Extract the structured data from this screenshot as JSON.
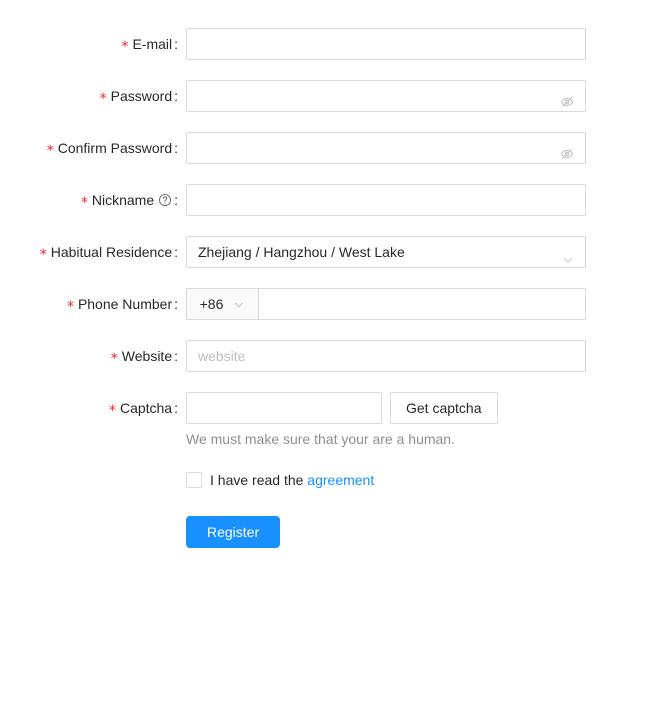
{
  "form": {
    "fields": {
      "email": {
        "label": "E-mail",
        "required_mark": "*",
        "colon": ":",
        "value": "",
        "placeholder": ""
      },
      "password": {
        "label": "Password",
        "required_mark": "*",
        "colon": ":",
        "value": "",
        "placeholder": "",
        "suffix_icon": "eye-invisible-icon"
      },
      "confirm_password": {
        "label": "Confirm Password",
        "required_mark": "*",
        "colon": ":",
        "value": "",
        "placeholder": "",
        "suffix_icon": "eye-invisible-icon"
      },
      "nickname": {
        "label": "Nickname",
        "required_mark": "*",
        "colon": ":",
        "value": "",
        "placeholder": "",
        "tooltip_icon": "question-circle-icon"
      },
      "residence": {
        "label": "Habitual Residence",
        "required_mark": "*",
        "colon": ":",
        "value": "Zhejiang / Hangzhou / West Lake",
        "suffix_icon": "chevron-down-icon"
      },
      "phone": {
        "label": "Phone Number",
        "required_mark": "*",
        "colon": ":",
        "country_code": "+86",
        "country_code_icon": "chevron-down-icon",
        "value": "",
        "placeholder": ""
      },
      "website": {
        "label": "Website",
        "required_mark": "*",
        "colon": ":",
        "value": "",
        "placeholder": "website"
      },
      "captcha": {
        "label": "Captcha",
        "required_mark": "*",
        "colon": ":",
        "value": "",
        "placeholder": "",
        "button_label": "Get captcha",
        "help_text": "We must make sure that your are a human."
      }
    },
    "agreement": {
      "checked": false,
      "text": "I have read the",
      "link_label": "agreement"
    },
    "submit": {
      "label": "Register"
    }
  },
  "colors": {
    "primary": "#1890ff",
    "required": "#f5222d",
    "link": "#1890ff",
    "border": "#d9d9d9",
    "placeholder": "#bfbfbf",
    "addon_bg": "#fafafa"
  }
}
